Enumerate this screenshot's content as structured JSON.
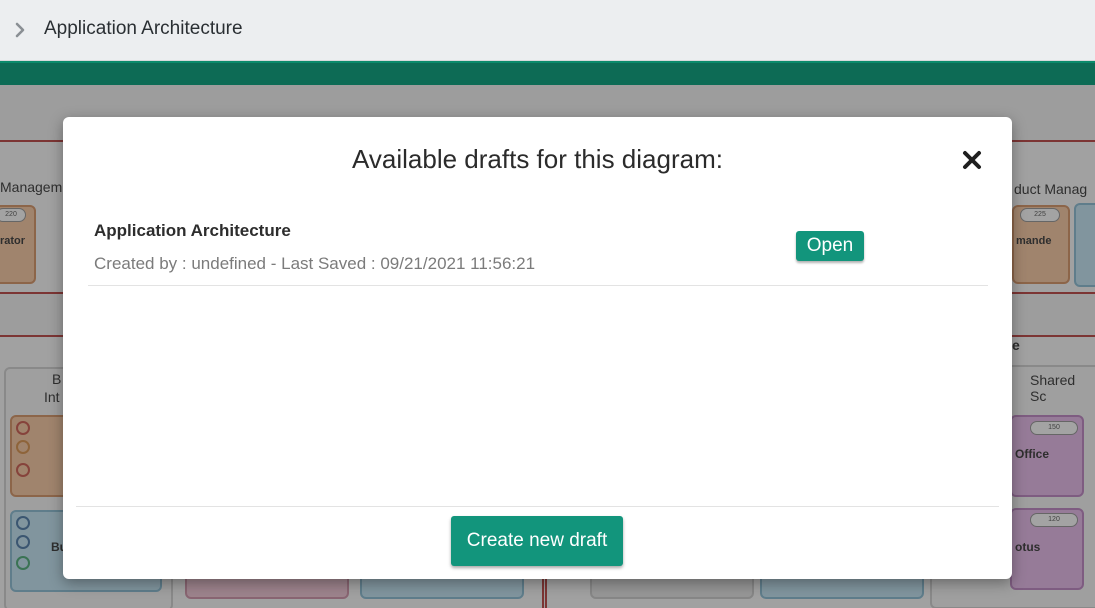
{
  "header": {
    "title": "Application Architecture",
    "chevron_icon": "chevron-right-icon"
  },
  "background": {
    "left_section_label": "Managem",
    "left_card_badge": "220",
    "left_card_text": "rator",
    "right_section_label": "duct Manag",
    "right_card_badge": "225",
    "right_card_text": "mande",
    "mid_left_label_1": "B",
    "mid_left_label_2": "Int",
    "mid_right_label": "e",
    "shared_label": "Shared Sc",
    "office_badge": "150",
    "office_text": "Office",
    "lotus_badge": "120",
    "lotus_text": "otus",
    "bu_text": "Bu"
  },
  "modal": {
    "title": "Available drafts for this diagram:",
    "close_icon": "close-icon",
    "drafts": [
      {
        "name": "Application Architecture",
        "meta": "Created by : undefined - Last Saved : 09/21/2021 11:56:21",
        "open_label": "Open"
      }
    ],
    "create_label": "Create new draft"
  },
  "colors": {
    "accent_bar": "#0d6b55",
    "button": "#12957c",
    "region_border": "#b5302f"
  }
}
